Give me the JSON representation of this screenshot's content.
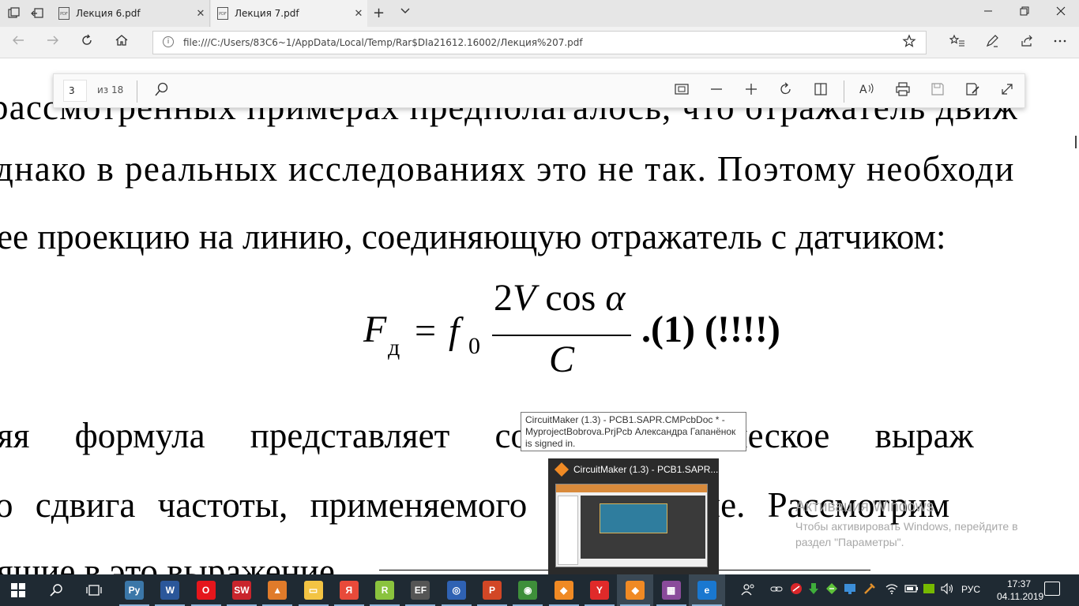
{
  "browser": {
    "tabs": [
      {
        "label": "Лекция 6.pdf",
        "active": false
      },
      {
        "label": "Лекция 7.pdf",
        "active": true
      }
    ],
    "close_glyph": "✕",
    "new_tab_glyph": "+",
    "address": "file:///C:/Users/83C6~1/AppData/Local/Temp/Rar$DIa21612.16002/Лекция%207.pdf"
  },
  "pdf_toolbar": {
    "current_page": "3",
    "page_count": "из 18"
  },
  "document": {
    "lines": [
      "рассмотренных примерах предполагалось, что отражатель движ",
      "днако в реальных исследованиях это не так. Поэтому необходи",
      "ее проекцию на линию, соединяющую отражатель с датчиком:"
    ],
    "formula": {
      "lhs": "F",
      "lhs_sub": "д",
      "equals": "=",
      "f": "f",
      "f_sub": "0",
      "numerator_2": "2",
      "numerator_V": "V",
      "numerator_cos": " cos ",
      "numerator_alpha": "α",
      "denominator": "C",
      "tail": ".(1) (!!!!)"
    },
    "lines_below": [
      "яя формула представляет собой классическое выраж",
      "о сдвига частоты, применяемого в медицине. Рассмотрим",
      "ящие в это выражение"
    ]
  },
  "watermark": {
    "title": "Активация Windows",
    "text": "Чтобы активировать Windows, перейдите в раздел \"Параметры\"."
  },
  "tooltip": {
    "text": "CircuitMaker (1.3) - PCB1.SAPR.CMPcbDoc * - MyprojectBobrova.PrjPcb Александра Гапанёнок is signed in."
  },
  "thumbnail": {
    "title": "CircuitMaker (1.3) - PCB1.SAPR...."
  },
  "taskbar": {
    "lang": "РУС",
    "time": "17:37",
    "date": "04.11.2019",
    "apps": [
      {
        "name": "python",
        "color": "#3b77a8",
        "glyph": "Py"
      },
      {
        "name": "word",
        "color": "#2b579a",
        "glyph": "W"
      },
      {
        "name": "opera",
        "color": "#e5161c",
        "glyph": "O"
      },
      {
        "name": "solidworks",
        "color": "#c9252c",
        "glyph": "SW"
      },
      {
        "name": "matlab",
        "color": "#e07b2a",
        "glyph": "▲"
      },
      {
        "name": "explorer",
        "color": "#f3c443",
        "glyph": "▭"
      },
      {
        "name": "yandex-disk",
        "color": "#e84a3a",
        "glyph": "Я"
      },
      {
        "name": "razer",
        "color": "#8ac33e",
        "glyph": "R"
      },
      {
        "name": "enemy-front",
        "color": "#555555",
        "glyph": "EF"
      },
      {
        "name": "circle-app",
        "color": "#2f62b3",
        "glyph": "◎"
      },
      {
        "name": "powerpoint",
        "color": "#d24726",
        "glyph": "P"
      },
      {
        "name": "chrome",
        "color": "#3e8f3a",
        "glyph": "◉"
      },
      {
        "name": "circuitmaker-1",
        "color": "#f08a24",
        "glyph": "◆"
      },
      {
        "name": "yandex-browser",
        "color": "#e02a2a",
        "glyph": "Y"
      },
      {
        "name": "circuitmaker-2",
        "color": "#f08a24",
        "glyph": "◆"
      },
      {
        "name": "winrar",
        "color": "#8a4b9b",
        "glyph": "▦"
      },
      {
        "name": "edge",
        "color": "#1a78d0",
        "glyph": "e"
      }
    ]
  }
}
